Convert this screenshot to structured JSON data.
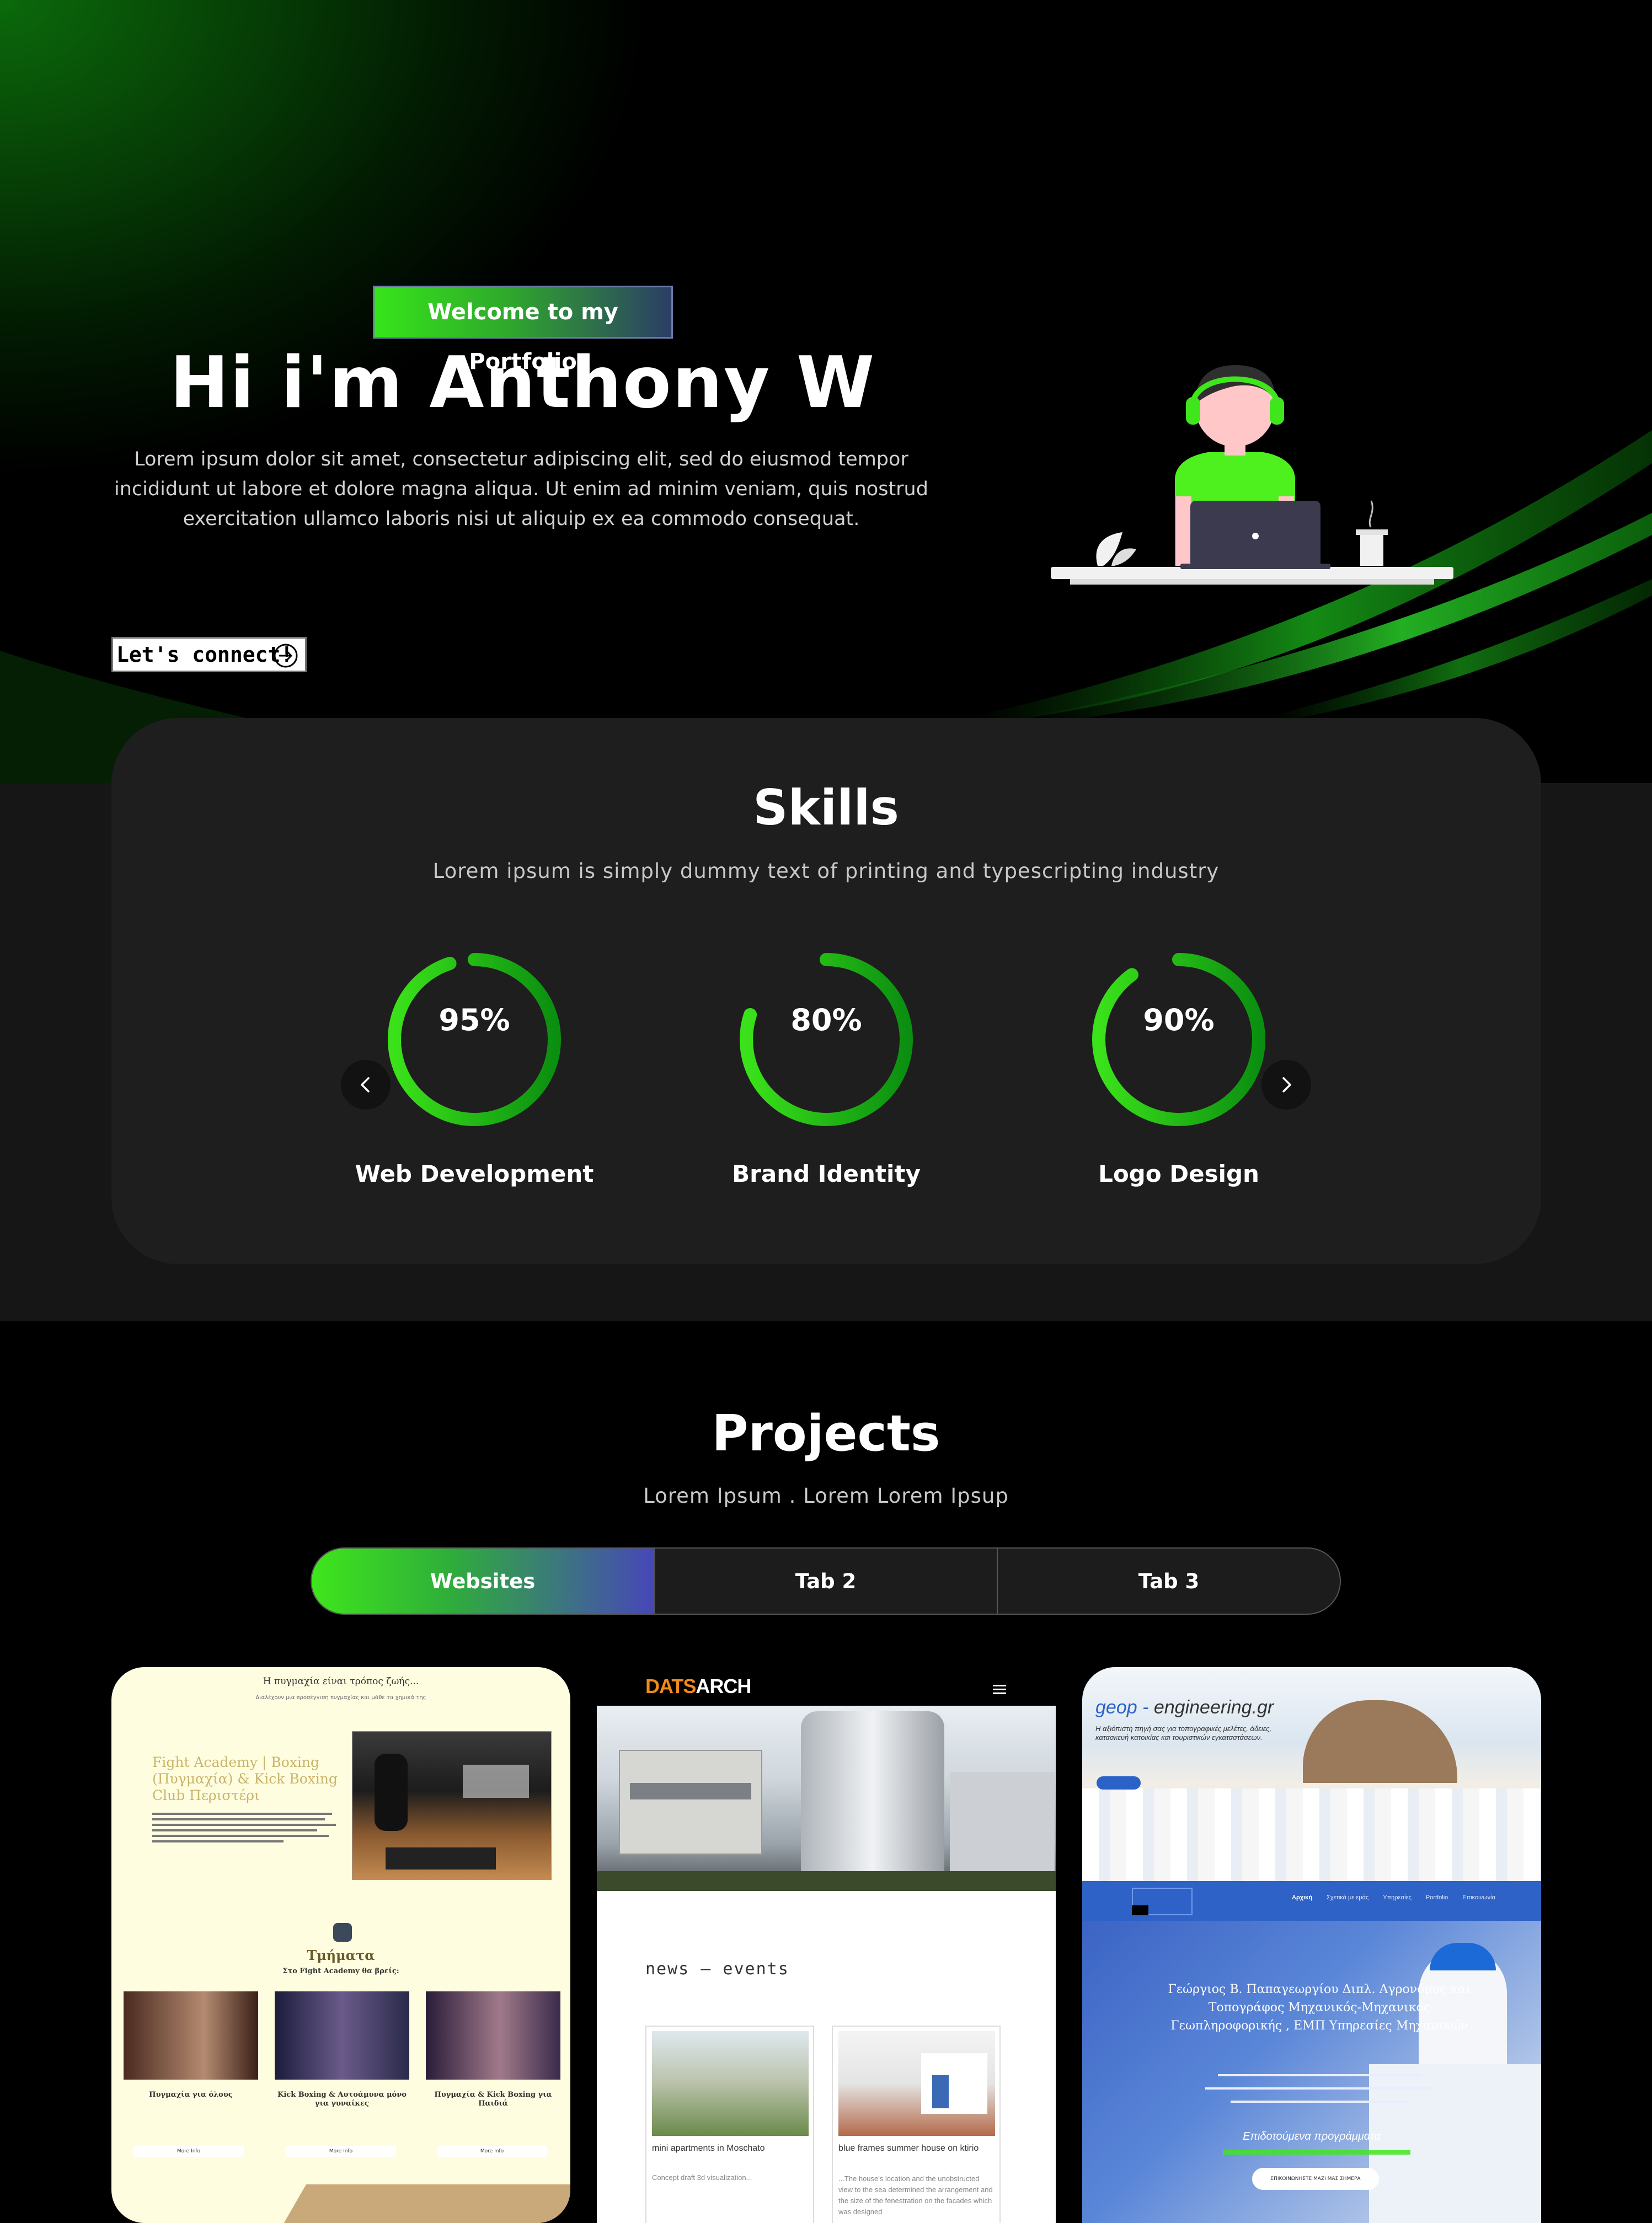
{
  "hero": {
    "welcome": "Welcome to my Portfolio",
    "title": "Hi i'm Anthony W",
    "description": "Lorem ipsum dolor sit amet, consectetur adipiscing elit, sed do eiusmod tempor incididunt ut labore et dolore magna aliqua. Ut enim ad minim veniam, quis nostrud exercitation ullamco laboris nisi ut aliquip ex ea commodo consequat.",
    "cta_label": "Let's connect!",
    "cta_icon": "arrow-right-circle-icon",
    "accent": "#3ee81c"
  },
  "skills": {
    "title": "Skills",
    "subtitle": "Lorem ipsum is simply dummy text of printing and typescripting industry",
    "items": [
      {
        "percent": 95,
        "value_label": "95%",
        "label": "Web Development"
      },
      {
        "percent": 80,
        "value_label": "80%",
        "label": "Brand Identity"
      },
      {
        "percent": 90,
        "value_label": "90%",
        "label": "Logo Design"
      }
    ],
    "prev_icon": "chevron-left-icon",
    "next_icon": "chevron-right-icon"
  },
  "projects": {
    "title": "Projects",
    "subtitle": "Lorem Ipsum . Lorem Lorem Ipsup",
    "tabs": [
      {
        "label": "Websites",
        "active": true
      },
      {
        "label": "Tab 2",
        "active": false
      },
      {
        "label": "Tab 3",
        "active": false
      }
    ],
    "cards": [
      {
        "header": "Η πυγμαχία είναι τρόπος ζωής...",
        "subheader": "Διαλέχουν μια προσέγγιση πυγμαχίας και μάθε τα χημικά της",
        "heading": "Fight Academy | Boxing (Πυγμαχία) & Kick Boxing Club Περιστέρι",
        "section_title": "Τμήματα",
        "section_sub": "Στο Fight Academy θα βρείς:",
        "columns": [
          "Πυγμαχία για όλους",
          "Kick Boxing & Αυτοάμυνα μόνο για γυναίκες",
          "Πυγμαχία & Kick Boxing για Παιδιά"
        ],
        "more": "More Info"
      },
      {
        "logo_a": "DATS",
        "logo_b": "ARCH",
        "news": "news – events",
        "item1_title": "mini apartments in Moschato",
        "item1_text": "Concept draft 3d visualization...",
        "item2_title": "blue frames summer house on ktirio",
        "item2_text": "...The house's location and the unobstructed view to the sea determined the arrangement and the size of the fenestration on the facades which was designed"
      },
      {
        "brand_a": "geop - ",
        "brand_b": "engineering.gr",
        "tagline": "Η αξιόπιστη πηγή σας για τοπογραφικές μελέτες, άδειες, κατασκευή κατοικίας και τουριστικών εγκαταστάσεων.",
        "nav": [
          "Αρχική",
          "Σχετικά με εμάς",
          "Υπηρεσίες",
          "Portfolio",
          "Επικοινωνία"
        ],
        "name": "Γεώργιος Β. Παπαγεωργίου Διπλ. Αγρονόμος και Τοπογράφος Μηχανικός-Μηχανικός Γεωπληροφορικής , ΕΜΠ Υπηρεσίες Μηχανικών",
        "featured": "Επιδοτούμενα προγράμματα",
        "button": "ΕΠΙΚΟΙΝΩΝΗΣΤΕ ΜΑΖΙ ΜΑΣ ΣΗΜΕΡΑ"
      }
    ]
  }
}
